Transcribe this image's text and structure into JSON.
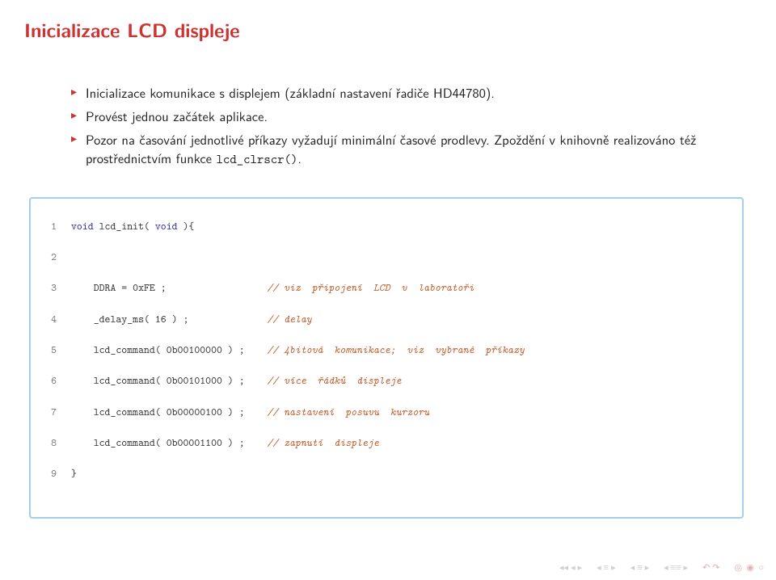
{
  "title": "Inicializace LCD displeje",
  "bullets": [
    "Inicializace komunikace s displejem (základní nastavení řadiče HD44780).",
    "Provést jednou začátek aplikace.",
    "Pozor na časování jednotlivé příkazy vyžadují minimální časové prodlevy. Zpoždění v knihovně realizováno též prostřednictvím funkce ",
    "lcd_clrscr()",
    "."
  ],
  "code": {
    "lineno": [
      "1",
      "2",
      "3",
      "4",
      "5",
      "6",
      "7",
      "8",
      "9"
    ],
    "l1_kw1": "void",
    "l1_fn": " lcd_init( ",
    "l1_kw2": "void",
    "l1_rest": " ){",
    "l3_body": "    DDRA = 0xFE ;                  ",
    "l3_cm": "// viz  připojení  LCD  v  laboratoři",
    "l4_body": "    _delay_ms( 16 ) ;              ",
    "l4_cm": "// delay",
    "l5_body": "    lcd_command( 0b00100000 ) ;    ",
    "l5_cm": "// 4bitová  komunikace;  viz  vybrané  příkazy",
    "l6_body": "    lcd_command( 0b00101000 ) ;    ",
    "l6_cm": "// více  řádků  displeje",
    "l7_body": "    lcd_command( 0b00000100 ) ;    ",
    "l7_cm": "// nastavení  posuvu  kurzoru",
    "l8_body": "    lcd_command( 0b00001100 ) ;    ",
    "l8_cm": "// zapnutí  displeje",
    "l9_body": "}"
  }
}
